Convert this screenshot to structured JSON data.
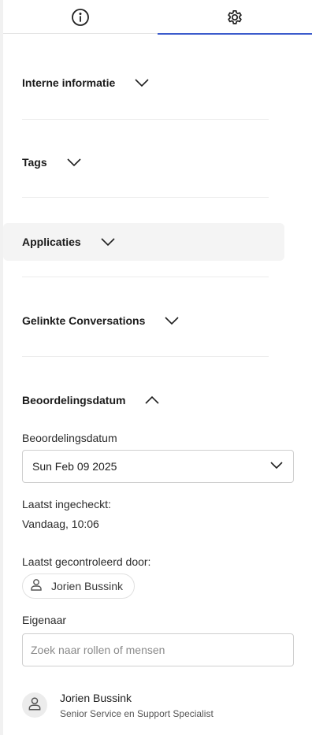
{
  "tabs": {
    "info_icon": "info-icon",
    "settings_icon": "gear-icon",
    "active": "settings"
  },
  "sections": {
    "internal_info": "Interne informatie",
    "tags": "Tags",
    "applications": "Applicaties",
    "linked_conversations": "Gelinkte Conversations",
    "review_date": "Beoordelingsdatum"
  },
  "review": {
    "date_label": "Beoordelingsdatum",
    "date_value": "Sun Feb 09 2025",
    "last_checked_label": "Laatst ingecheckt:",
    "last_checked_value": "Vandaag, 10:06",
    "last_reviewed_by_label": "Laatst gecontroleerd door:",
    "reviewer_name": "Jorien Bussink",
    "owner_label": "Eigenaar",
    "owner_search_placeholder": "Zoek naar rollen of mensen",
    "owner_name": "Jorien Bussink",
    "owner_role": "Senior Service en Support Specialist"
  },
  "colors": {
    "accent": "#3b5bcc",
    "border": "#cfcfcf",
    "hover": "#f4f4f4"
  }
}
